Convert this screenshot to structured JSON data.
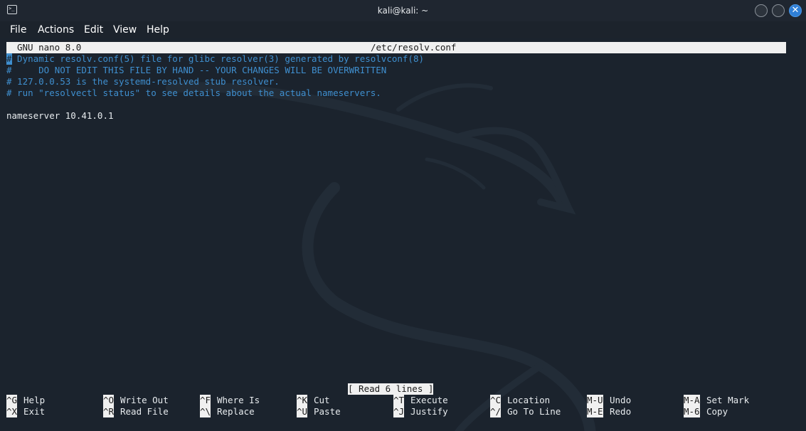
{
  "window": {
    "title": "kali@kali: ~",
    "icon": "terminal-icon",
    "close_glyph": "✕"
  },
  "menu": [
    "File",
    "Actions",
    "Edit",
    "View",
    "Help"
  ],
  "nano": {
    "version": "GNU nano 8.0",
    "filename": "/etc/resolv.conf",
    "cursor_char": "#",
    "lines": [
      " Dynamic resolv.conf(5) file for glibc resolver(3) generated by resolvconf(8)",
      "#     DO NOT EDIT THIS FILE BY HAND -- YOUR CHANGES WILL BE OVERWRITTEN",
      "# 127.0.0.53 is the systemd-resolved stub resolver.",
      "# run \"resolvectl status\" to see details about the actual nameservers.",
      "",
      "nameserver 10.41.0.1"
    ],
    "status": "[ Read 6 lines ]",
    "shortcuts": [
      [
        {
          "key": "^G",
          "label": "Help"
        },
        {
          "key": "^O",
          "label": "Write Out"
        },
        {
          "key": "^F",
          "label": "Where Is"
        },
        {
          "key": "^K",
          "label": "Cut"
        },
        {
          "key": "^T",
          "label": "Execute"
        },
        {
          "key": "^C",
          "label": "Location"
        },
        {
          "key": "M-U",
          "label": "Undo"
        },
        {
          "key": "M-A",
          "label": "Set Mark"
        }
      ],
      [
        {
          "key": "^X",
          "label": "Exit"
        },
        {
          "key": "^R",
          "label": "Read File"
        },
        {
          "key": "^\\",
          "label": "Replace"
        },
        {
          "key": "^U",
          "label": "Paste"
        },
        {
          "key": "^J",
          "label": "Justify"
        },
        {
          "key": "^/",
          "label": "Go To Line"
        },
        {
          "key": "M-E",
          "label": "Redo"
        },
        {
          "key": "M-6",
          "label": "Copy"
        }
      ]
    ]
  },
  "colors": {
    "background": "#1b232d",
    "comment": "#3f8fcf",
    "text": "#e8ecef",
    "close_button": "#2f7fd6"
  }
}
